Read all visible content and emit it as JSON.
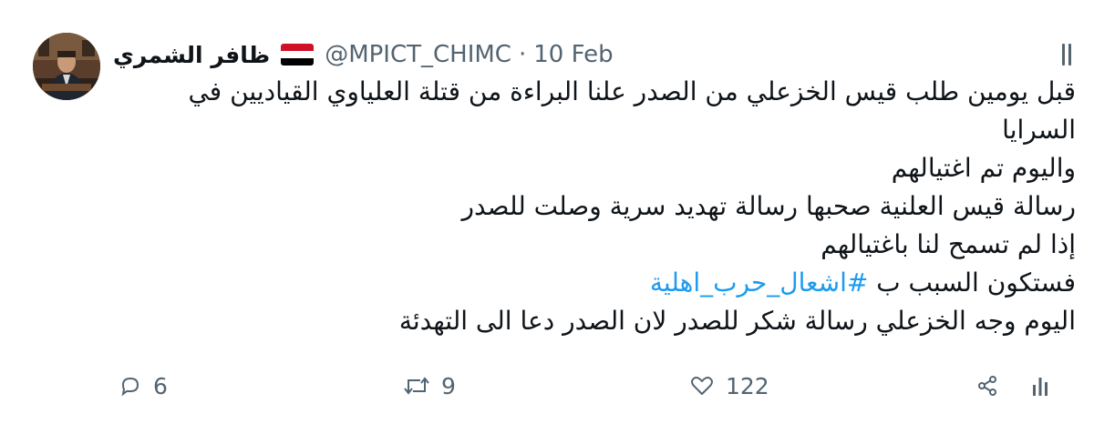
{
  "tweet": {
    "display_name": "ظافر الشمري",
    "handle": "@MPICT_CHIMC",
    "separator": "·",
    "date": "10 Feb",
    "lines": [
      "قبل يومين طلب قيس الخزعلي من الصدر علنا البراءة من قتلة العلياوي القياديين في",
      "السرايا",
      "واليوم تم اغتيالهم",
      "رسالة قيس العلنية صحبها رسالة تهديد سرية وصلت للصدر",
      "إذا لم تسمح لنا باغتيالهم",
      "فستكون السبب ب",
      "اليوم وجه الخزعلي رسالة شكر للصدر لان الصدر دعا الى التهدئة"
    ],
    "hashtag": "#اشعال_حرب_اهلية",
    "flag": "yemen-flag",
    "avatar": "profile-photo"
  },
  "actions": {
    "reply_count": "6",
    "retweet_count": "9",
    "like_count": "122"
  },
  "icons": {
    "reply": "reply-icon",
    "retweet": "retweet-icon",
    "like": "heart-icon",
    "share": "share-icon",
    "analytics": "analytics-icon",
    "more": "more-icon"
  },
  "colors": {
    "text": "#0f1419",
    "secondary": "#536471",
    "link": "#1d9bf0"
  }
}
